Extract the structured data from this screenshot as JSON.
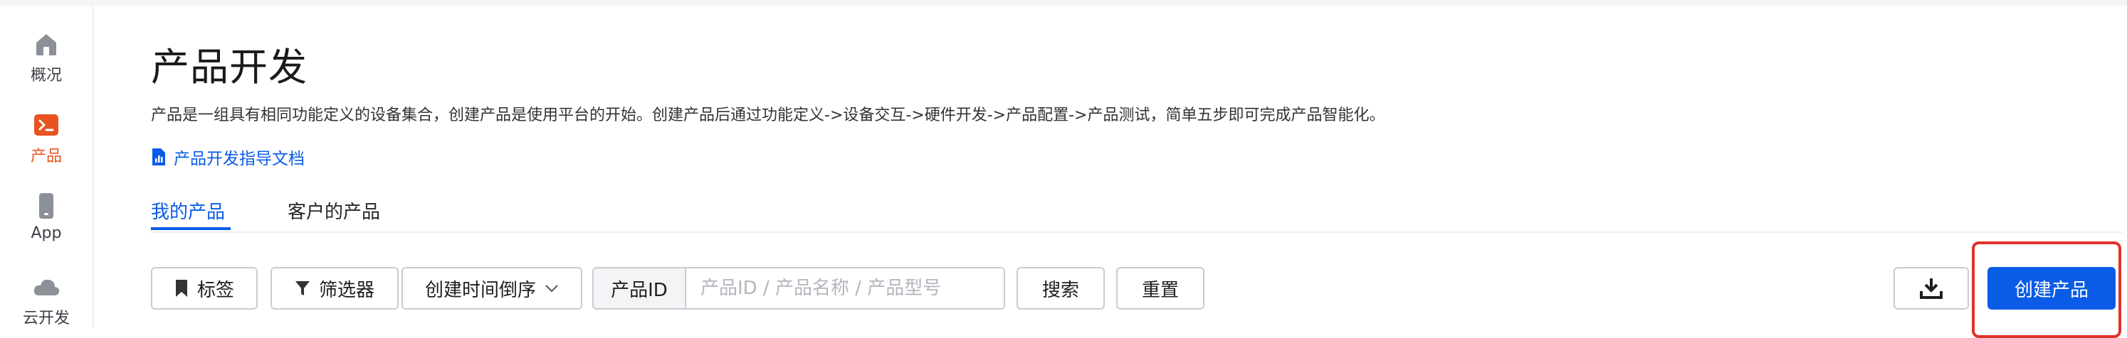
{
  "sidebar": {
    "items": [
      {
        "label": "概况",
        "icon": "home-icon",
        "active": false
      },
      {
        "label": "产品",
        "icon": "terminal-icon",
        "active": true
      },
      {
        "label": "App",
        "icon": "phone-icon",
        "active": false
      },
      {
        "label": "云开发",
        "icon": "cloud-icon",
        "active": false
      }
    ]
  },
  "page": {
    "title": "产品开发",
    "description": "产品是一组具有相同功能定义的设备集合，创建产品是使用平台的开始。创建产品后通过功能定义->设备交互->硬件开发->产品配置->产品测试，简单五步即可完成产品智能化。",
    "doc_link": {
      "label": "产品开发指导文档",
      "icon": "document-chart-icon"
    }
  },
  "tabs": [
    {
      "label": "我的产品",
      "active": true
    },
    {
      "label": "客户的产品",
      "active": false
    }
  ],
  "toolbar": {
    "tag_button": {
      "label": "标签",
      "icon": "bookmark-icon"
    },
    "filter_button": {
      "label": "筛选器",
      "icon": "filter-icon"
    },
    "sort_select": {
      "value": "创建时间倒序",
      "icon": "chevron-down-icon"
    },
    "search_field": {
      "label": "产品ID",
      "placeholder": "产品ID / 产品名称 / 产品型号",
      "value": ""
    },
    "search_button": {
      "label": "搜索"
    },
    "reset_button": {
      "label": "重置"
    },
    "download_button": {
      "icon": "download-icon"
    },
    "create_button": {
      "label": "创建产品"
    }
  },
  "colors": {
    "accent": "#0a5ce6",
    "active_nav": "#e8541f",
    "highlight": "#e0322a"
  }
}
